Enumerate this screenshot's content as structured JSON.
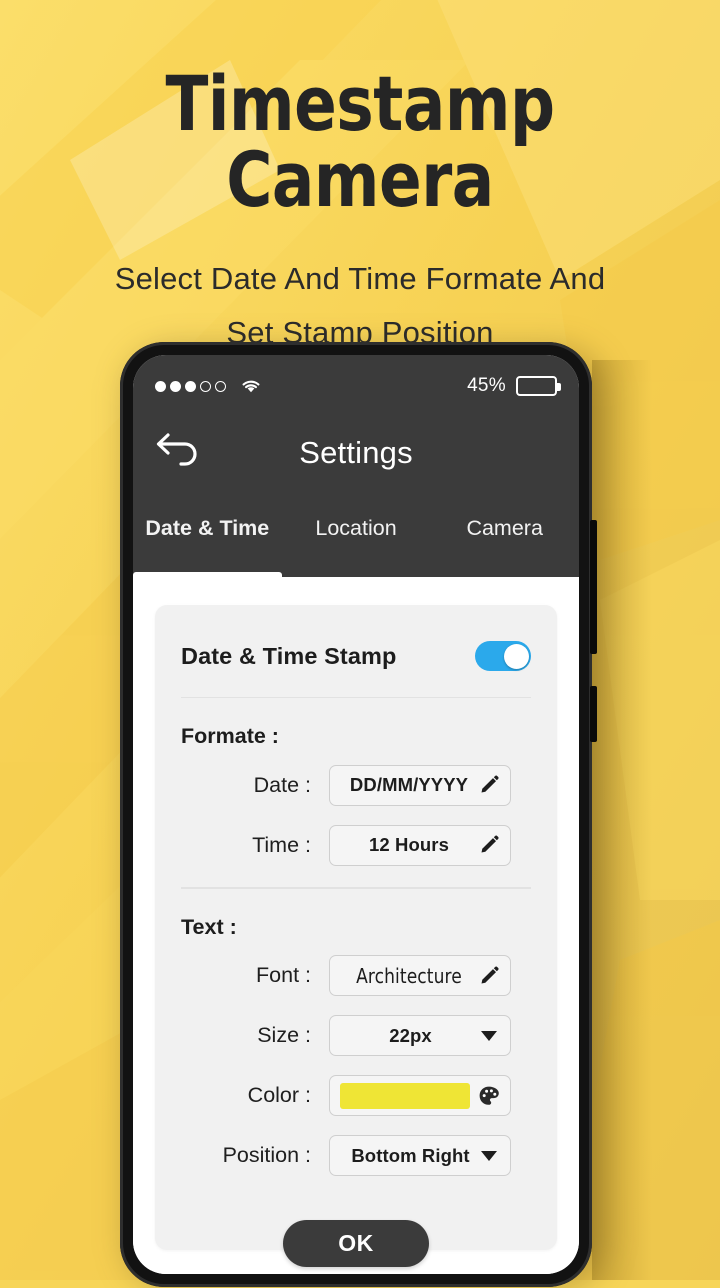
{
  "page": {
    "title": "Timestamp Camera",
    "subtitle_line1": "Select Date And Time Formate And",
    "subtitle_line2": "Set Stamp Position",
    "background_color_top_left": "#F8D85C",
    "background_color_bottom_right": "#E8C558"
  },
  "phone": {
    "frame_color": "#121212",
    "statusbar": {
      "signal_icon": "signal-dots-icon",
      "signal_bars_filled": 3,
      "signal_bars_total": 5,
      "wifi_icon": "wifi-icon",
      "battery_percent_label": "45%",
      "battery_level": 45,
      "battery_icon": "battery-icon"
    },
    "appbar": {
      "back_icon": "back-arrow-icon",
      "title": "Settings",
      "background_color": "#3B3B3B",
      "tabs": [
        {
          "label": "Date & Time",
          "active": true
        },
        {
          "label": "Location",
          "active": false
        },
        {
          "label": "Camera",
          "active": false
        }
      ]
    },
    "card": {
      "header": {
        "label": "Date & Time Stamp",
        "toggle_state": "on",
        "toggle_color": "#2BA9EB"
      },
      "sections": [
        {
          "title": "Formate :",
          "rows": [
            {
              "label": "Date :",
              "value": "DD/MM/YYYY",
              "control": "edit",
              "icon": "pencil-icon"
            },
            {
              "label": "Time :",
              "value": "12 Hours",
              "control": "edit",
              "icon": "pencil-icon"
            }
          ]
        },
        {
          "title": "Text :",
          "rows": [
            {
              "label": "Font :",
              "value": "Architecture",
              "control": "edit",
              "icon": "pencil-icon"
            },
            {
              "label": "Size :",
              "value": "22px",
              "control": "dropdown",
              "icon": "chevron-down-icon"
            },
            {
              "label": "Color :",
              "value": "",
              "control": "color",
              "icon": "palette-icon",
              "swatch_color": "#EFE535"
            },
            {
              "label": "Position :",
              "value": "Bottom Right",
              "control": "dropdown",
              "icon": "chevron-down-icon"
            }
          ]
        }
      ],
      "ok_button_label": "OK"
    }
  }
}
